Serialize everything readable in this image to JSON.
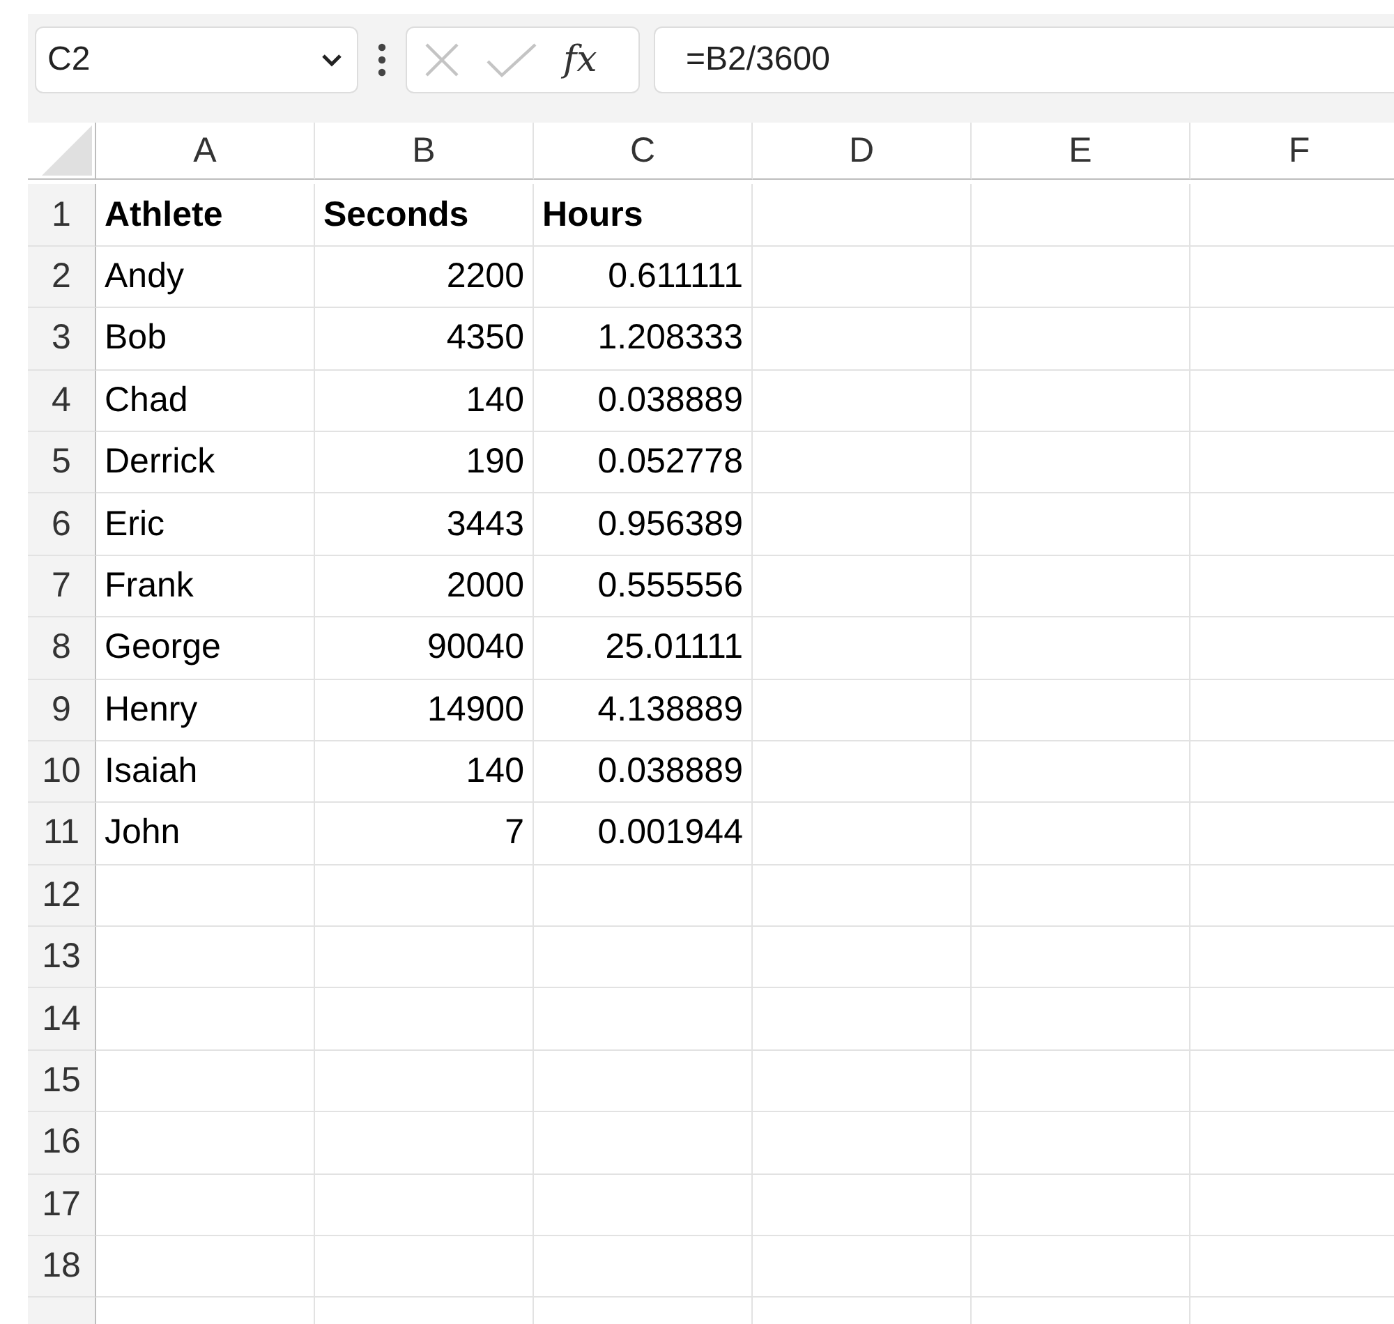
{
  "formula_bar": {
    "name_box": "C2",
    "function_label": "fx",
    "formula": "=B2/3600"
  },
  "columns": [
    "A",
    "B",
    "C",
    "D",
    "E",
    "F"
  ],
  "rows": [
    {
      "number": "1",
      "kind": "header",
      "cells": [
        "Athlete",
        "Seconds",
        "Hours"
      ]
    },
    {
      "number": "2",
      "kind": "data",
      "cells": [
        "Andy",
        "2200",
        "0.611111"
      ]
    },
    {
      "number": "3",
      "kind": "data",
      "cells": [
        "Bob",
        "4350",
        "1.208333"
      ]
    },
    {
      "number": "4",
      "kind": "data",
      "cells": [
        "Chad",
        "140",
        "0.038889"
      ]
    },
    {
      "number": "5",
      "kind": "data",
      "cells": [
        "Derrick",
        "190",
        "0.052778"
      ]
    },
    {
      "number": "6",
      "kind": "data",
      "cells": [
        "Eric",
        "3443",
        "0.956389"
      ]
    },
    {
      "number": "7",
      "kind": "data",
      "cells": [
        "Frank",
        "2000",
        "0.555556"
      ]
    },
    {
      "number": "8",
      "kind": "data",
      "cells": [
        "George",
        "90040",
        "25.01111"
      ]
    },
    {
      "number": "9",
      "kind": "data",
      "cells": [
        "Henry",
        "14900",
        "4.138889"
      ]
    },
    {
      "number": "10",
      "kind": "data",
      "cells": [
        "Isaiah",
        "140",
        "0.038889"
      ]
    },
    {
      "number": "11",
      "kind": "data",
      "cells": [
        "John",
        "7",
        "0.001944"
      ]
    },
    {
      "number": "12",
      "kind": "data"
    },
    {
      "number": "13",
      "kind": "data"
    },
    {
      "number": "14",
      "kind": "data"
    },
    {
      "number": "15",
      "kind": "data"
    },
    {
      "number": "16",
      "kind": "data"
    },
    {
      "number": "17",
      "kind": "data"
    },
    {
      "number": "18",
      "kind": "data"
    },
    {
      "kind": "data"
    }
  ]
}
